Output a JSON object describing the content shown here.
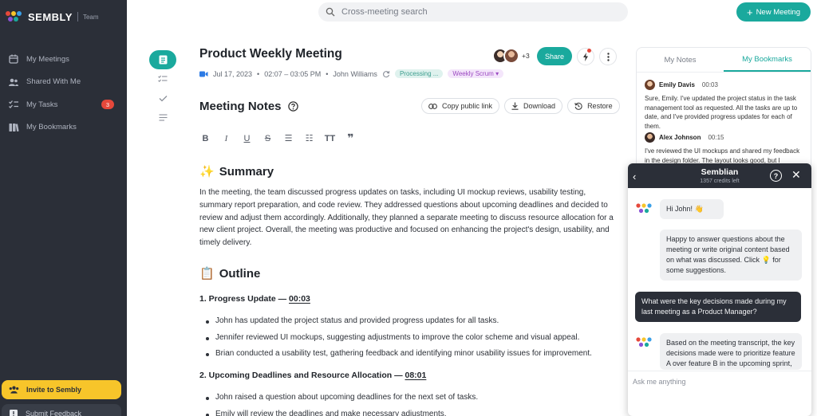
{
  "app": {
    "logo_text": "SEMBLY",
    "logo_sub": "Team"
  },
  "sidebar": {
    "items": [
      {
        "label": "My Meetings",
        "icon": "calendar-icon"
      },
      {
        "label": "Shared With Me",
        "icon": "people-icon"
      },
      {
        "label": "My Tasks",
        "icon": "tasks-icon",
        "badge": "3"
      },
      {
        "label": "My Bookmarks",
        "icon": "bookmark-icon"
      }
    ],
    "invite_label": "Invite to Sembly",
    "feedback_label": "Submit Feedback"
  },
  "topbar": {
    "search_placeholder": "Cross-meeting search",
    "new_meeting_label": "New Meeting"
  },
  "meeting": {
    "title": "Product Weekly Meeting",
    "date": "Jul 17, 2023",
    "time": "02:07 – 03:05 PM",
    "host": "John Williams",
    "status_tag": "Processing ...",
    "type_tag": "Weekly Scrum",
    "extra_participants": "+3",
    "share_label": "Share"
  },
  "notes": {
    "heading": "Meeting Notes",
    "copy_link_label": "Copy public link",
    "download_label": "Download",
    "restore_label": "Restore",
    "summary_title": "Summary",
    "summary_emoji": "✨",
    "summary_text": "In the meeting, the team discussed progress updates on tasks, including UI mockup reviews, usability testing, summary report preparation, and code review. They addressed questions about upcoming deadlines and decided to review and adjust them accordingly. Additionally, they planned a separate meeting to discuss resource allocation for a new client project. Overall, the meeting was productive and focused on enhancing the project's design, usability, and timely delivery.",
    "outline_title": "Outline",
    "outline_emoji": "📋",
    "section1_title": "1. Progress Update — ",
    "section1_time": "00:03",
    "section1_bullets": [
      "John has updated the project status and provided progress updates for all tasks.",
      "Jennifer reviewed UI mockups, suggesting adjustments to improve the color scheme and visual appeal.",
      "Brian conducted a usability test, gathering feedback and identifying minor usability issues for improvement."
    ],
    "section2_title": "2. Upcoming Deadlines and Resource Allocation — ",
    "section2_time": "08:01",
    "section2_bullets": [
      "John raised a question about upcoming deadlines for the next set of tasks.",
      "Emily will review the deadlines and make necessary adjustments."
    ]
  },
  "right_panel": {
    "tab_notes": "My Notes",
    "tab_bookmarks": "My Bookmarks",
    "bookmarks": [
      {
        "name": "Emily Davis",
        "time": "00:03",
        "text": "Sure, Emily. I've updated the project status in the task management tool as requested. All the tasks are up to date, and I've provided progress updates for each of them."
      },
      {
        "name": "Alex Johnson",
        "time": "00:15",
        "text": "I've reviewed the UI mockups and shared my feedback in the design folder. The layout looks good, but I suggested a few adjustments to"
      }
    ]
  },
  "chat": {
    "title": "Semblian",
    "credits": "1357 credits left",
    "messages": [
      "Hi John! 👋",
      "Happy to answer questions about the meeting or write original content based on what was discussed. Click 💡 for some suggestions.",
      "What were the key decisions made during my last meeting as a Product Manager?",
      "Based on the meeting transcript, the key decisions made were to prioritize feature A over feature B in the upcoming sprint,"
    ],
    "input_placeholder": "Ask me anything"
  },
  "colors": {
    "accent": "#1aa99d",
    "sidebar_bg": "#2b2f38",
    "invite_bg": "#f7c52a",
    "badge": "#e5483b"
  }
}
